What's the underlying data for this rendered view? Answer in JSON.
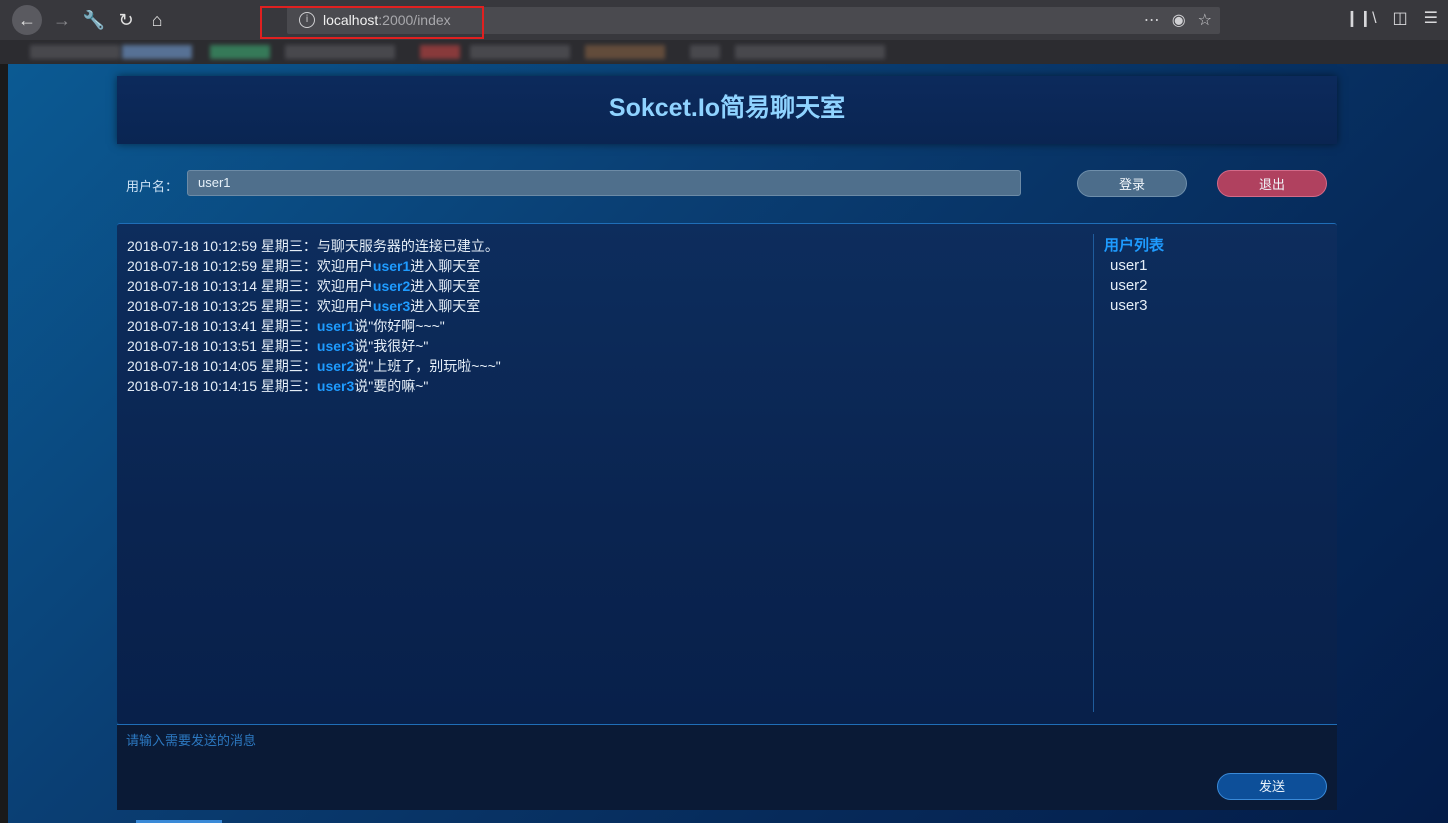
{
  "browser": {
    "url_host": "localhost",
    "url_rest": ":2000/index",
    "info_icon": "info-icon"
  },
  "page": {
    "title": "Sokcet.Io简易聊天室",
    "username_label": "用户名：",
    "username_value": "user1",
    "login_label": "登录",
    "logout_label": "退出",
    "messages": [
      {
        "prefix": "2018-07-18 10:12:59 星期三：与聊天服务器的连接已建立。",
        "user": "",
        "suffix": ""
      },
      {
        "prefix": "2018-07-18 10:12:59 星期三：欢迎用户",
        "user": "user1",
        "suffix": "进入聊天室"
      },
      {
        "prefix": "2018-07-18 10:13:14 星期三：欢迎用户",
        "user": "user2",
        "suffix": "进入聊天室"
      },
      {
        "prefix": "2018-07-18 10:13:25 星期三：欢迎用户",
        "user": "user3",
        "suffix": "进入聊天室"
      },
      {
        "prefix": "2018-07-18 10:13:41 星期三：",
        "user": "user1",
        "suffix": "说\"你好啊~~~\""
      },
      {
        "prefix": "2018-07-18 10:13:51 星期三：",
        "user": "user3",
        "suffix": "说\"我很好~\""
      },
      {
        "prefix": "2018-07-18 10:14:05 星期三：",
        "user": "user2",
        "suffix": "说\"上班了，别玩啦~~~\""
      },
      {
        "prefix": "2018-07-18 10:14:15 星期三：",
        "user": "user3",
        "suffix": "说\"要的嘛~\""
      }
    ],
    "userlist_title": "用户列表",
    "users": [
      "user1",
      "user2",
      "user3"
    ],
    "message_placeholder": "请输入需要发送的消息",
    "send_label": "发送"
  },
  "colors": {
    "accent": "#1e9bff",
    "title": "#8fd3ff",
    "logout": "#b0415f",
    "highlight_box": "#e02020"
  }
}
